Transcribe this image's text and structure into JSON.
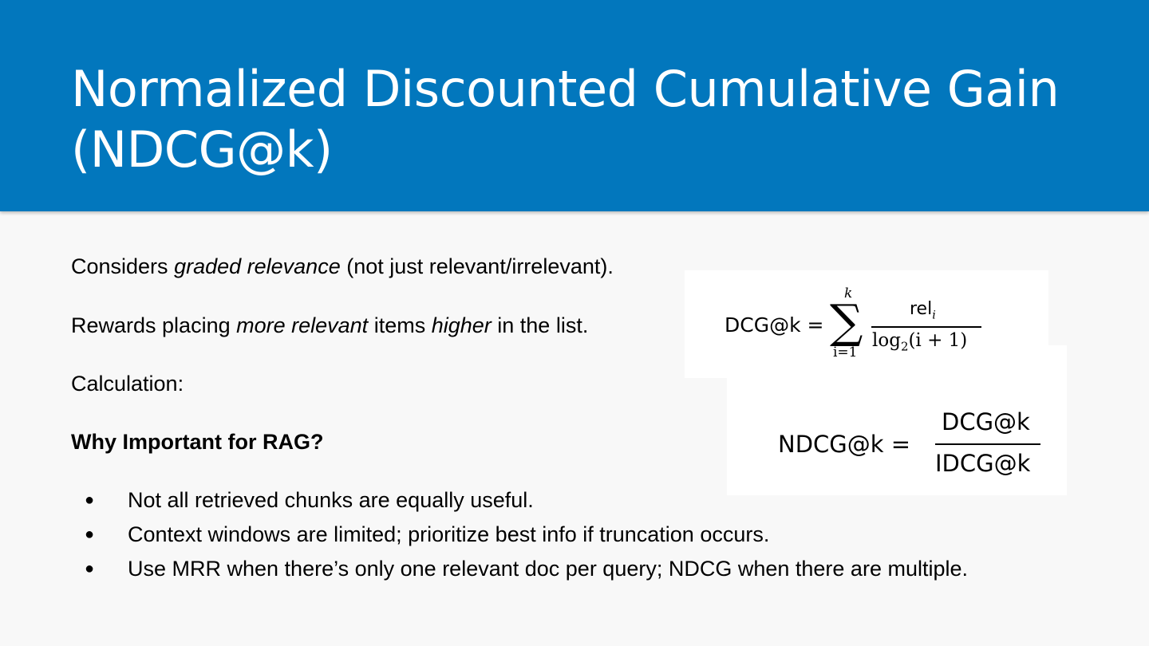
{
  "slide": {
    "title": "Normalized Discounted Cumulative Gain (NDCG@k)",
    "accent_color": "#0277bd"
  },
  "body": {
    "p1": {
      "a": "Considers ",
      "em": "graded relevance",
      "b": " (not just relevant/irrelevant)."
    },
    "p2": {
      "a": "Rewards placing ",
      "em1": "more relevant",
      "b": " items ",
      "em2": "higher",
      "c": " in the list."
    },
    "p3": "Calculation:",
    "p4": "Why Important for RAG?",
    "bullet_glyph": "●",
    "bullets": [
      "Not all retrieved chunks are equally useful.",
      "Context windows are limited; prioritize best info if truncation occurs.",
      "Use MRR when there’s only one relevant doc per query; NDCG when there are multiple."
    ]
  },
  "formulas": {
    "dcg": {
      "lhs": "DCG@k =",
      "sigma": "∑",
      "upper": "k",
      "lower": "i=1",
      "num_main": "rel",
      "num_sub": "i",
      "den_a": "log",
      "den_sub": "2",
      "den_b": "(i + 1)"
    },
    "ndcg": {
      "lhs": "NDCG@k =",
      "num": "DCG@k",
      "den": "IDCG@k"
    }
  }
}
